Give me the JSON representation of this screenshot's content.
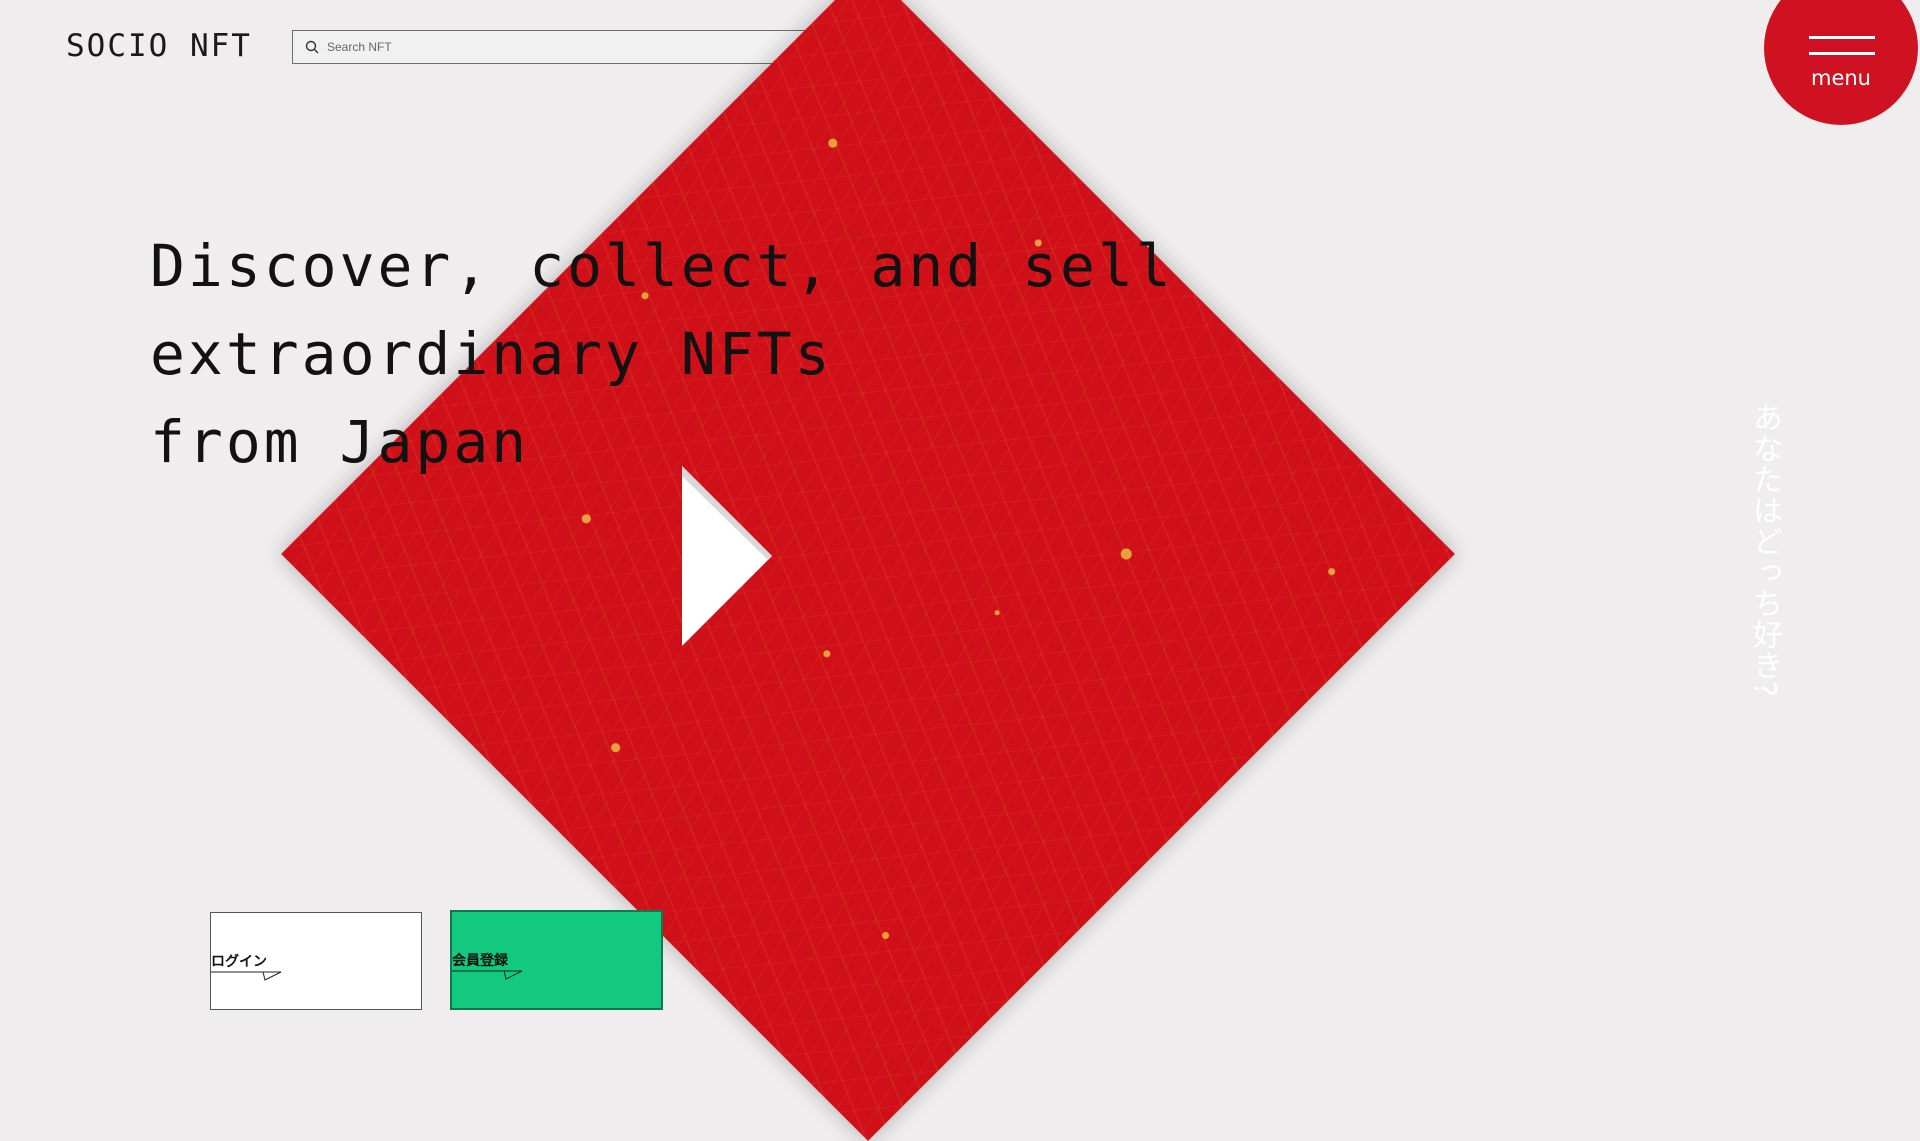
{
  "header": {
    "logo": "SOCIO NFT",
    "search": {
      "placeholder": "Search NFT"
    }
  },
  "hero": {
    "headline": [
      "Discover, collect, and sell",
      "extraordinary NFTs",
      "from Japan"
    ],
    "vertical_text": "あなたはどっち好き?"
  },
  "buttons": {
    "login_label": "ログイン",
    "register_label": "会員登録"
  },
  "menu": {
    "label": "menu"
  },
  "colors": {
    "background": "#efedee",
    "accent_red": "#cf1018",
    "register_green": "#12c97f"
  }
}
